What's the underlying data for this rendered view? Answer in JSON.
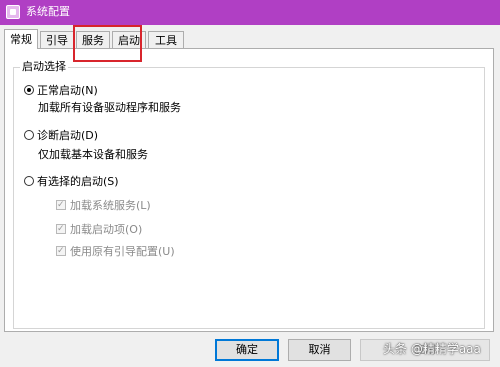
{
  "window": {
    "title": "系统配置"
  },
  "tabs": [
    {
      "label": "常规"
    },
    {
      "label": "引导"
    },
    {
      "label": "服务"
    },
    {
      "label": "启动"
    },
    {
      "label": "工具"
    }
  ],
  "group": {
    "legend": "启动选择"
  },
  "options": {
    "normal": {
      "label": "正常启动(N)",
      "desc": "加载所有设备驱动程序和服务"
    },
    "diagnostic": {
      "label": "诊断启动(D)",
      "desc": "仅加载基本设备和服务"
    },
    "selective": {
      "label": "有选择的启动(S)"
    }
  },
  "checkboxes": [
    {
      "label": "加载系统服务(L)"
    },
    {
      "label": "加载启动项(O)"
    },
    {
      "label": "使用原有引导配置(U)"
    }
  ],
  "buttons": {
    "ok": "确定",
    "cancel": "取消",
    "apply": "应用"
  },
  "watermark": "头条 @精精学aaa",
  "colors": {
    "titlebar": "#b03fc4",
    "highlight": "#d8252c"
  }
}
